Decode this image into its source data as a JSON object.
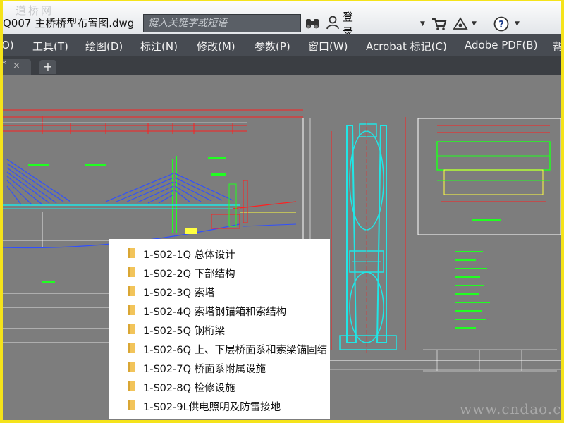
{
  "window": {
    "watermark_top": "道桥网",
    "file_title": "Q007 主桥桥型布置图.dwg",
    "watermark_bottom": "www.cndao.com"
  },
  "search": {
    "placeholder": "键入关键字或短语"
  },
  "toolbar": {
    "login_label": "登录",
    "icons": [
      "binoculars-icon",
      "user-icon",
      "cart-icon",
      "exchange-icon",
      "help-icon"
    ]
  },
  "menubar": {
    "items": [
      {
        "label": "O)"
      },
      {
        "label": "工具(T)"
      },
      {
        "label": "绘图(D)"
      },
      {
        "label": "标注(N)"
      },
      {
        "label": "修改(M)"
      },
      {
        "label": "参数(P)"
      },
      {
        "label": "窗口(W)"
      },
      {
        "label": "Acrobat 标记(C)"
      },
      {
        "label": "Adobe PDF(B)"
      },
      {
        "label": "帮"
      }
    ]
  },
  "tabs": {
    "doc_tab_marker": "*",
    "close_glyph": "×",
    "add_glyph": "+"
  },
  "folder_list": {
    "items": [
      {
        "label": "1-S02-1Q 总体设计"
      },
      {
        "label": "1-S02-2Q 下部结构"
      },
      {
        "label": "1-S02-3Q 索塔"
      },
      {
        "label": "1-S02-4Q 索塔钢锚箱和索结构"
      },
      {
        "label": "1-S02-5Q 钢桁梁"
      },
      {
        "label": "1-S02-6Q 上、下层桥面系和索梁锚固结"
      },
      {
        "label": "1-S02-7Q 桥面系附属设施"
      },
      {
        "label": "1-S02-8Q 检修设施"
      },
      {
        "label": "1-S02-9L供电照明及防雷接地"
      }
    ]
  },
  "colors": {
    "menubar_bg": "#474b52",
    "canvas_bg": "#7d7d7d",
    "frame_border": "#f5e31a",
    "folder_icon": "#f2c45a",
    "cad_red": "#ff2020",
    "cad_green": "#20ff20",
    "cad_cyan": "#20e6e6",
    "cad_blue": "#3050ff",
    "cad_white": "#ffffff"
  }
}
